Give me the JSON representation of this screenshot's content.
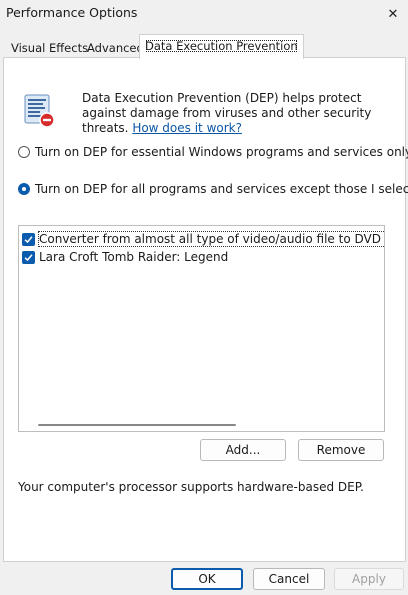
{
  "window": {
    "title": "Performance Options",
    "close_glyph": "✕"
  },
  "tabs": [
    {
      "label": "Visual Effects",
      "active": false
    },
    {
      "label": "Advanced",
      "active": false
    },
    {
      "label": "Data Execution Prevention",
      "active": true
    }
  ],
  "description": {
    "text": "Data Execution Prevention (DEP) helps protect against damage from viruses and other security threats. ",
    "link": "How does it work?",
    "icon": "dep-shield-icon"
  },
  "options": {
    "essential": {
      "label": "Turn on DEP for essential Windows programs and services only",
      "selected": false
    },
    "all_except": {
      "label": "Turn on DEP for all programs and services except those I select:",
      "selected": true
    }
  },
  "exceptions": [
    {
      "label": "Converter from almost all type of video/audio file to DVD that can be",
      "checked": true
    },
    {
      "label": "Lara Croft Tomb Raider: Legend",
      "checked": true
    }
  ],
  "buttons": {
    "add": "Add...",
    "remove": "Remove",
    "ok": "OK",
    "cancel": "Cancel",
    "apply": "Apply"
  },
  "info": "Your computer's processor supports hardware-based DEP.",
  "colors": {
    "accent": "#0b5cad",
    "link": "#0b57a6",
    "window_bg": "#f0f0f0"
  }
}
